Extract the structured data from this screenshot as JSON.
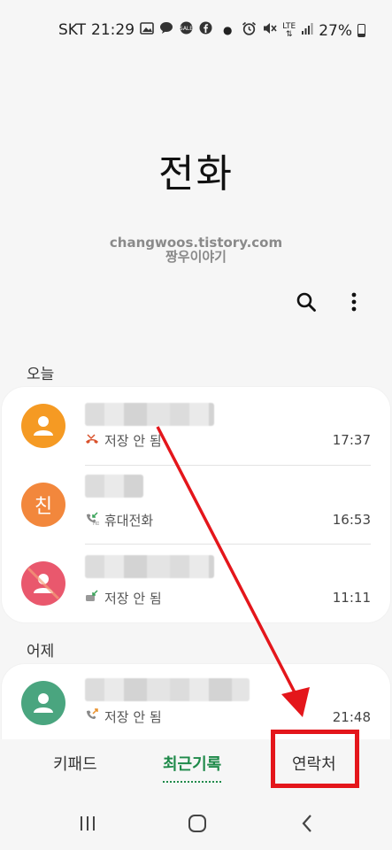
{
  "status_bar": {
    "carrier": "SKT",
    "time": "21:29",
    "lte": "LTE",
    "battery": "27%"
  },
  "title": "전화",
  "watermark": {
    "line1": "changwoos.tistory.com",
    "line2": "짱우이야기"
  },
  "toolbar": {
    "search_icon": "search-icon",
    "more_icon": "more-vertical-icon"
  },
  "sections": [
    {
      "label": "오늘",
      "calls": [
        {
          "avatar_color": "#f59a23",
          "avatar_letter": "",
          "status": "저장 안 됨",
          "call_type": "missed",
          "time": "17:37"
        },
        {
          "avatar_color": "#f2873c",
          "avatar_letter": "친",
          "status": "휴대전화",
          "call_type": "hd-incoming",
          "time": "16:53"
        },
        {
          "avatar_color": "#e9586d",
          "avatar_letter": "",
          "status": "저장 안 됨",
          "call_type": "rejected",
          "time": "11:11"
        }
      ]
    },
    {
      "label": "어제",
      "calls": [
        {
          "avatar_color": "#4aa57f",
          "avatar_letter": "",
          "status": "저장 안 됨",
          "call_type": "outgoing",
          "time": "21:48"
        }
      ]
    }
  ],
  "tabs": {
    "keypad": "키패드",
    "recents": "최근기록",
    "contacts": "연락처"
  },
  "annotation_color": "#e4161b",
  "accent_color": "#1f8a4a"
}
